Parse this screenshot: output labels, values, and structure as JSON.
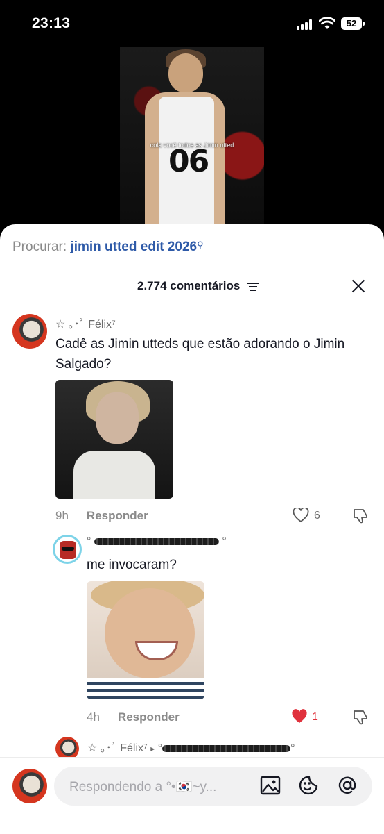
{
  "status_bar": {
    "time": "23:13",
    "battery": "52"
  },
  "video": {
    "caption": "cola você todos as Jimin utted",
    "shirt_number": "06"
  },
  "search": {
    "label": "Procurar:",
    "query": "jimin utted edit 2026"
  },
  "comments_header": {
    "count_label": "2.774 comentários"
  },
  "comments": [
    {
      "username_prefix": "☆ ｡･ﾟ Félix⁷",
      "text": "Cadê as Jimin utteds que estão adorando o Jimin Salgado?",
      "time": "9h",
      "reply_label": "Responder",
      "likes": "6",
      "liked": false
    },
    {
      "username_prefix": "°",
      "username_suffix": "°",
      "text": "me invocaram?",
      "time": "4h",
      "reply_label": "Responder",
      "likes": "1",
      "liked": true
    },
    {
      "username_prefix": "☆ ｡･ﾟ Félix⁷",
      "arrow": "▸",
      "reply_to_prefix": "°",
      "reply_to_suffix": "°"
    }
  ],
  "composer": {
    "placeholder": "Respondendo a °•🇰🇷~y..."
  },
  "colors": {
    "link": "#2e5aa8",
    "like_red": "#e0313c",
    "text": "#161823",
    "muted": "#8a8a8a"
  },
  "icons": [
    "signal-icon",
    "wifi-icon",
    "battery-icon",
    "search-icon",
    "filter-icon",
    "close-icon",
    "heart-icon",
    "dislike-icon",
    "image-icon",
    "emoji-icon",
    "mention-icon"
  ]
}
